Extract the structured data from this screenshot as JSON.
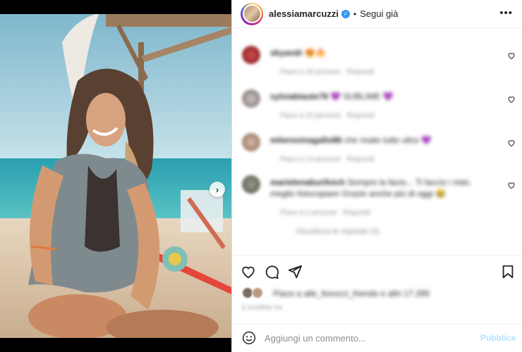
{
  "post": {
    "username": "alessiamarcuzzi",
    "follow_status": "Segui già",
    "separator": "•",
    "more_icon": "more-horizontal-icon",
    "verified_icon": "verified-badge-icon"
  },
  "photo": {
    "next_icon": "chevron-right-icon",
    "next_glyph": "›"
  },
  "comments": [
    {
      "author": "skyandr",
      "text": "😍🔥",
      "likes_label": "Piace a 28 persone",
      "reply_label": "Rispondi"
    },
    {
      "author": "sylviabiaute78",
      "text": "💜 SUBLIME 💜",
      "likes_label": "Piace a 10 persone",
      "reply_label": "Rispondi"
    },
    {
      "author": "miteresinagallo86",
      "text": "che risate tutte ultra 💜",
      "likes_label": "Piace a 14 persone",
      "reply_label": "Rispondi"
    },
    {
      "author": "marielenaburilvich",
      "text": "Sempre la facio... Ti faccio i miei, meglio fotocopiare Grazie anche più di oggi 😂",
      "likes_label": "Piace a 2 persone",
      "reply_label": "Rispondi"
    }
  ],
  "replies_toggle": "Visualizza le risposte (4)",
  "likes": {
    "text": "Piace a alle_fiorucci_friends e altri 17.285"
  },
  "date": "5 GIORNI FA",
  "composer": {
    "placeholder": "Aggiungi un commento...",
    "publish_label": "Pubblica",
    "emoji_icon": "smiley-icon"
  },
  "colors": {
    "accent": "#0095f6",
    "publish_disabled": "#b2dffc",
    "verified": "#3897f0"
  }
}
